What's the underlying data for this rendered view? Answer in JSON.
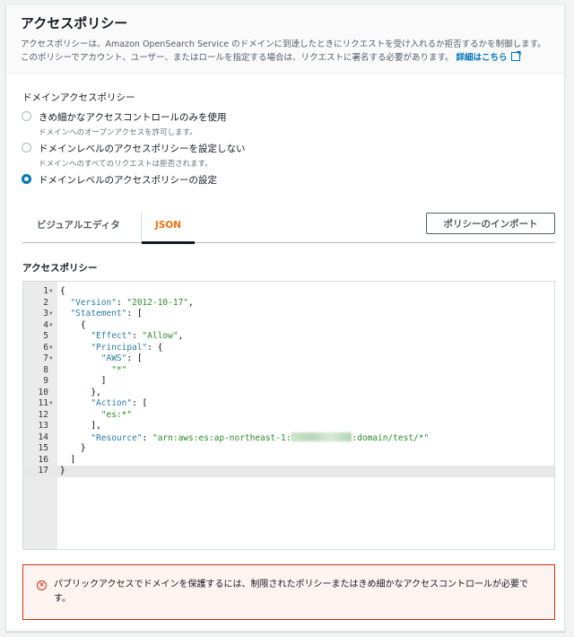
{
  "header": {
    "title": "アクセスポリシー",
    "description": "アクセスポリシーは、Amazon OpenSearch Service のドメインに到達したときにリクエストを受け入れるか拒否するかを制御します。このポリシーでアカウント、ユーザー、またはロールを指定する場合は、リクエストに署名する必要があります。",
    "link": "詳細はこちら"
  },
  "domain_policy": {
    "label": "ドメインアクセスポリシー",
    "options": [
      {
        "label": "きめ細かなアクセスコントロールのみを使用",
        "sub": "ドメインへのオープンアクセスを許可します。",
        "selected": false
      },
      {
        "label": "ドメインレベルのアクセスポリシーを設定しない",
        "sub": "ドメインへのすべてのリクエストは拒否されます。",
        "selected": false
      },
      {
        "label": "ドメインレベルのアクセスポリシーの設定",
        "selected": true
      }
    ]
  },
  "tabs": [
    {
      "label": "ビジュアルエディタ"
    },
    {
      "label": "JSON",
      "active": true
    }
  ],
  "import_button": "ポリシーのインポート",
  "editor_label": "アクセスポリシー",
  "code": [
    {
      "n": "1",
      "f": true,
      "t": [
        [
          "p",
          "{"
        ]
      ]
    },
    {
      "n": "2",
      "t": [
        [
          "p",
          "  "
        ],
        [
          "k",
          "\"Version\""
        ],
        [
          "p",
          ": "
        ],
        [
          "s",
          "\"2012-10-17\""
        ],
        [
          "p",
          ","
        ]
      ]
    },
    {
      "n": "3",
      "f": true,
      "t": [
        [
          "p",
          "  "
        ],
        [
          "k",
          "\"Statement\""
        ],
        [
          "p",
          ": ["
        ]
      ]
    },
    {
      "n": "4",
      "f": true,
      "t": [
        [
          "p",
          "    {"
        ]
      ]
    },
    {
      "n": "5",
      "t": [
        [
          "p",
          "      "
        ],
        [
          "k",
          "\"Effect\""
        ],
        [
          "p",
          ": "
        ],
        [
          "s",
          "\"Allow\""
        ],
        [
          "p",
          ","
        ]
      ]
    },
    {
      "n": "6",
      "f": true,
      "t": [
        [
          "p",
          "      "
        ],
        [
          "k",
          "\"Principal\""
        ],
        [
          "p",
          ": {"
        ]
      ]
    },
    {
      "n": "7",
      "f": true,
      "t": [
        [
          "p",
          "        "
        ],
        [
          "k",
          "\"AWS\""
        ],
        [
          "p",
          ": ["
        ]
      ]
    },
    {
      "n": "8",
      "t": [
        [
          "p",
          "          "
        ],
        [
          "s",
          "\"*\""
        ]
      ]
    },
    {
      "n": "9",
      "t": [
        [
          "p",
          "        ]"
        ]
      ]
    },
    {
      "n": "10",
      "t": [
        [
          "p",
          "      },"
        ]
      ]
    },
    {
      "n": "11",
      "f": true,
      "t": [
        [
          "p",
          "      "
        ],
        [
          "k",
          "\"Action\""
        ],
        [
          "p",
          ": ["
        ]
      ]
    },
    {
      "n": "12",
      "t": [
        [
          "p",
          "        "
        ],
        [
          "s",
          "\"es:*\""
        ]
      ]
    },
    {
      "n": "13",
      "t": [
        [
          "p",
          "      ],"
        ]
      ]
    },
    {
      "n": "14",
      "t": [
        [
          "p",
          "      "
        ],
        [
          "k",
          "\"Resource\""
        ],
        [
          "p",
          ": "
        ],
        [
          "s",
          "\"arn:aws:es:ap-northeast-1:"
        ],
        [
          "r",
          ""
        ],
        [
          "s",
          ":domain/test/*\""
        ]
      ]
    },
    {
      "n": "15",
      "t": [
        [
          "p",
          "    }"
        ]
      ]
    },
    {
      "n": "16",
      "t": [
        [
          "p",
          "  ]"
        ]
      ]
    },
    {
      "n": "17",
      "cur": true,
      "t": [
        [
          "p",
          "}"
        ]
      ]
    }
  ],
  "alert": {
    "text": "パブリックアクセスでドメインを保護するには、制限されたポリシーまたはきめ細かなアクセスコントロールが必要です。"
  },
  "colors": {
    "accent": "#0073bb",
    "tab_active": "#ec7211",
    "error": "#d13212"
  }
}
